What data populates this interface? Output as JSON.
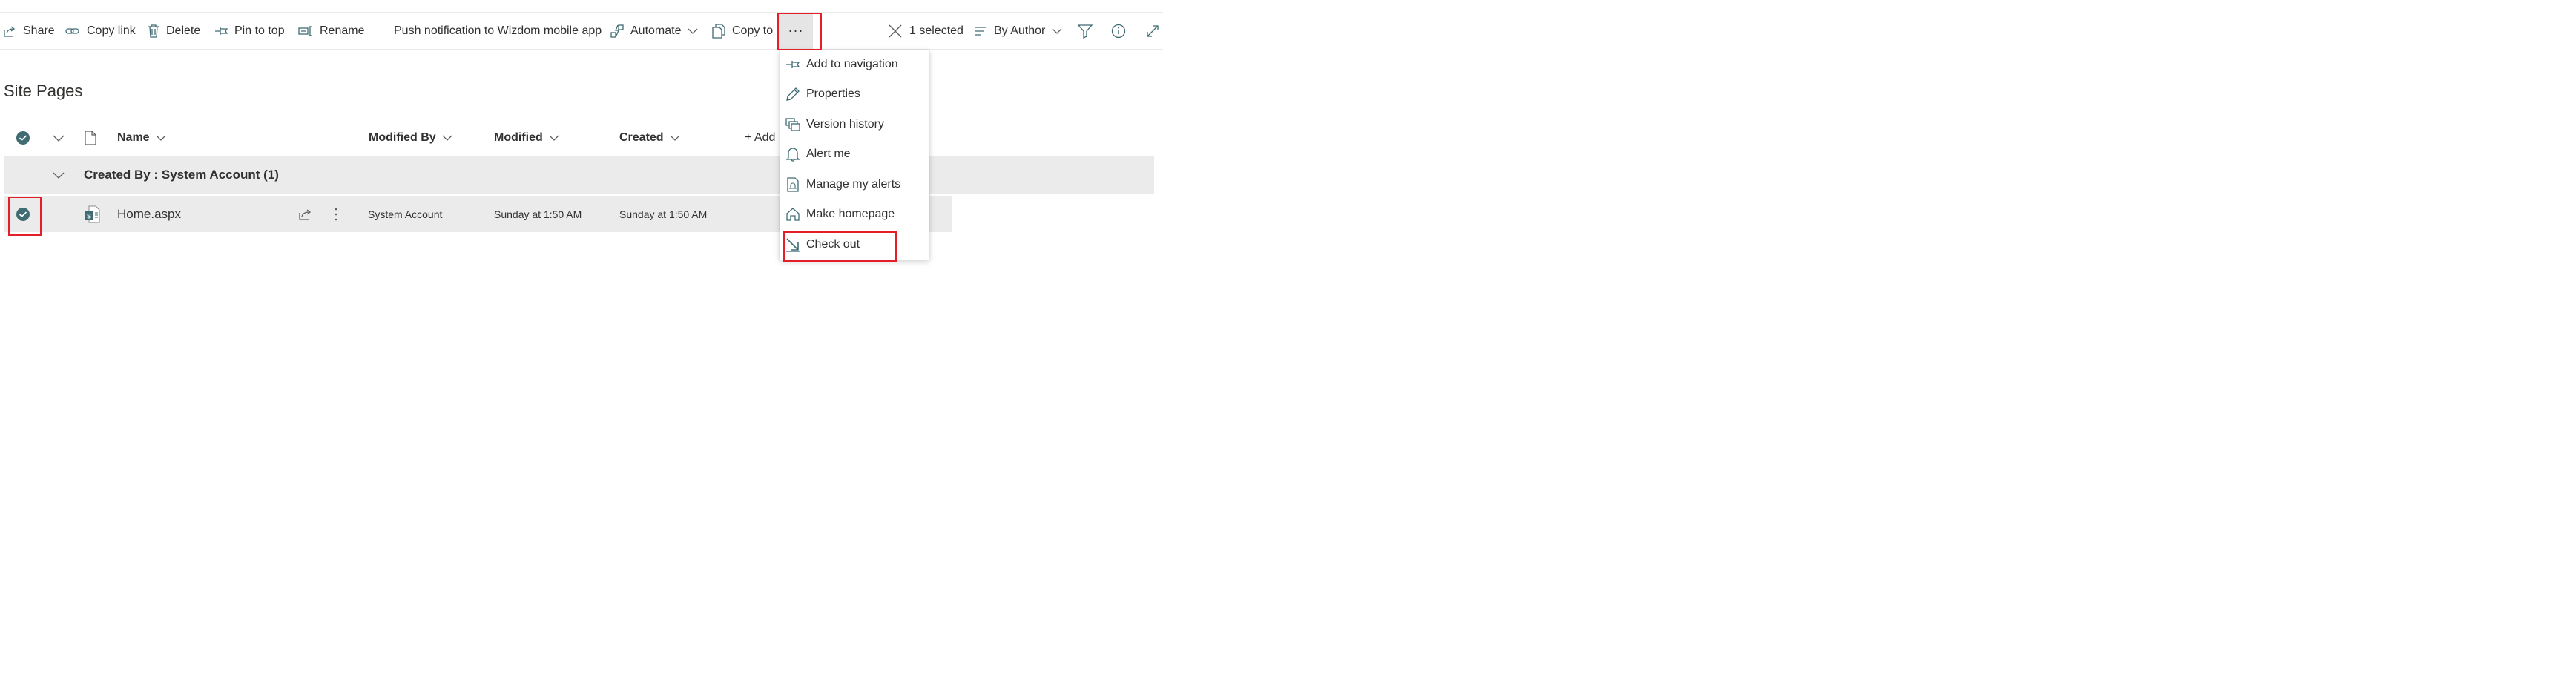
{
  "commandbar": {
    "share": "Share",
    "copy_link": "Copy link",
    "delete": "Delete",
    "pin_to_top": "Pin to top",
    "rename": "Rename",
    "push_notification": "Push notification to Wizdom mobile app",
    "automate": "Automate",
    "copy_to": "Copy to",
    "more": "···",
    "selected": "1 selected",
    "view": "By Author"
  },
  "page": {
    "title": "Site Pages"
  },
  "columns": {
    "name": "Name",
    "modified_by": "Modified By",
    "modified": "Modified",
    "created": "Created",
    "add_column": "+ Add"
  },
  "group": {
    "label": "Created By : System Account (1)"
  },
  "rows": [
    {
      "name": "Home.aspx",
      "modified_by": "System Account",
      "modified": "Sunday at 1:50 AM",
      "created": "Sunday at 1:50 AM",
      "selected": true
    }
  ],
  "menu": {
    "items": [
      {
        "label": "Add to navigation",
        "icon": "pin-navigation-icon"
      },
      {
        "label": "Properties",
        "icon": "pencil-icon"
      },
      {
        "label": "Version history",
        "icon": "version-history-icon"
      },
      {
        "label": "Alert me",
        "icon": "bell-icon"
      },
      {
        "label": "Manage my alerts",
        "icon": "manage-alerts-icon"
      },
      {
        "label": "Make homepage",
        "icon": "home-icon"
      },
      {
        "label": "Check out",
        "icon": "check-out-arrow-icon"
      }
    ]
  },
  "colors": {
    "accent": "#3f6b73",
    "highlight": "#e3202a",
    "row_background": "#ebebeb",
    "text": "#323130"
  }
}
